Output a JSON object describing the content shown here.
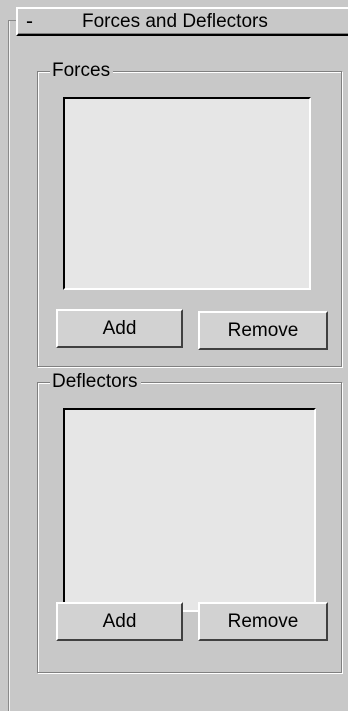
{
  "rollout": {
    "collapse_symbol": "-",
    "title": "Forces and Deflectors"
  },
  "forces": {
    "label": "Forces",
    "items": [],
    "add_label": "Add",
    "remove_label": "Remove"
  },
  "deflectors": {
    "label": "Deflectors",
    "items": [],
    "add_label": "Add",
    "remove_label": "Remove"
  },
  "colors": {
    "panel_bg": "#c8c8c8",
    "list_bg": "#e6e6e6",
    "button_bg": "#d2d2d2"
  }
}
